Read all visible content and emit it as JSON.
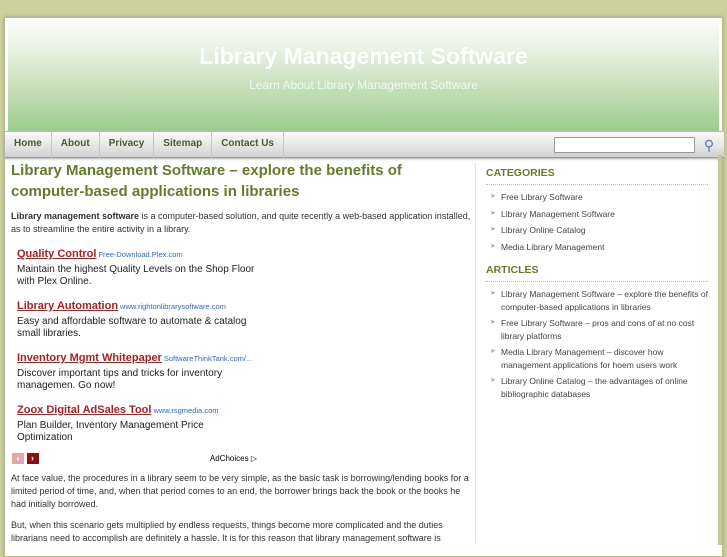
{
  "header": {
    "title": "Library Management Software",
    "tagline": "Learn About Library Management Software"
  },
  "nav": {
    "items": [
      "Home",
      "About",
      "Privacy",
      "Sitemap",
      "Contact Us"
    ],
    "search_placeholder": "",
    "search_icon": "magnifier-icon"
  },
  "article": {
    "title": "Library Management Software – explore the benefits of computer-based applications in libraries",
    "intro_bold": "Library management software",
    "intro_rest": " is a computer-based solution, and quite recently a web-based application installed, as to streamline the entire activity in a library.",
    "para1": "At face value, the procedures in a library seem to be very simple, as the basic task is borrowing/lending books for a limited period of time, and, when that period comes to an end, the borrower brings back the book or the books he had initially borrowed.",
    "para2": "But, when this scenario gets multiplied by endless requests, things become more complicated and the duties librarians need to accomplish are definitely a hassle. It is for this reason that library management software is"
  },
  "ads": [
    {
      "title": "Quality Control",
      "url": "Free-Download.Plex.com",
      "desc": "Maintain the highest Quality Levels on the Shop Floor with Plex Online."
    },
    {
      "title": "Library Automation",
      "url": "www.rightonlibrarysoftware.com",
      "desc": "Easy and affordable software to automate & catalog small libraries."
    },
    {
      "title": "Inventory Mgmt Whitepaper",
      "url": "SoftwareThinkTank.com/...",
      "desc": "Discover important tips and tricks for inventory managemen. Go now!"
    },
    {
      "title": "Zoox Digital AdSales Tool",
      "url": "www.rsgmedia.com",
      "desc": "Plan Builder, Inventory Management Price Optimization"
    }
  ],
  "adchoices": "AdChoices",
  "sidebar": {
    "categories_title": "CATEGORIES",
    "categories": [
      "Free Library Software",
      "Library Management Software",
      "Library Online Catalog",
      "Media Library Management"
    ],
    "articles_title": "ARTICLES",
    "articles": [
      "Library Management Software – explore the benefits of computer-based applications in libraries",
      "Free Library Software – pros and cons of at no cost library platforms",
      "Media Library Management – discover how management applications for hoem users work",
      "Library Online Catalog – the advantages of online bibliographic databases"
    ]
  },
  "colors": {
    "accent": "#667a2e",
    "ad_title": "#a52222",
    "ad_url": "#3366cc"
  }
}
